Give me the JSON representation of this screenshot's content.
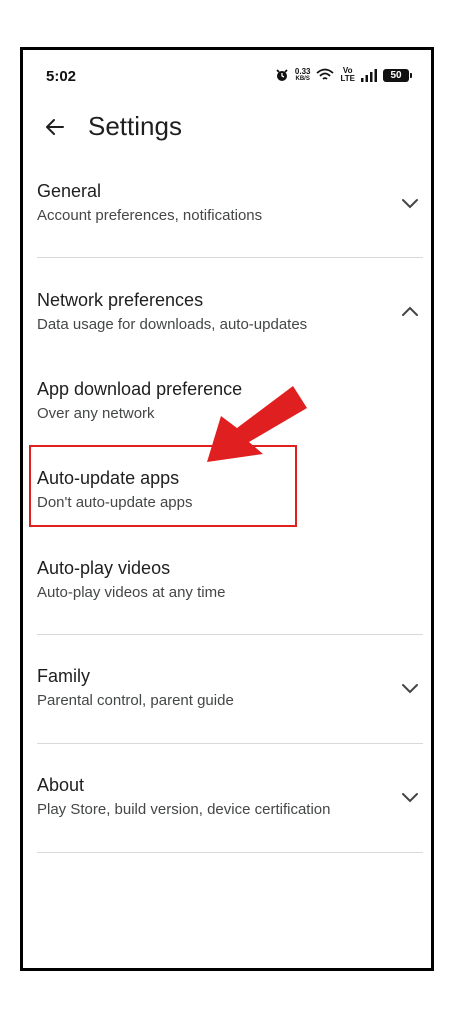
{
  "status_bar": {
    "time": "5:02",
    "net_speed_value": "0.33",
    "net_speed_unit": "KB/S",
    "volte_line1": "Vo",
    "volte_line2": "LTE",
    "battery": "50"
  },
  "app_bar": {
    "back_icon": "arrow-left-icon",
    "title": "Settings"
  },
  "sections": {
    "general": {
      "title": "General",
      "subtitle": "Account preferences, notifications",
      "state": "collapsed"
    },
    "network": {
      "title": "Network preferences",
      "subtitle": "Data usage for downloads, auto-updates",
      "state": "expanded"
    },
    "app_download": {
      "title": "App download preference",
      "subtitle": "Over any network"
    },
    "auto_update": {
      "title": "Auto-update apps",
      "subtitle": "Don't auto-update apps"
    },
    "auto_play": {
      "title": "Auto-play videos",
      "subtitle": "Auto-play videos at any time"
    },
    "family": {
      "title": "Family",
      "subtitle": "Parental control, parent guide",
      "state": "collapsed"
    },
    "about": {
      "title": "About",
      "subtitle": "Play Store, build version, device certification",
      "state": "collapsed"
    }
  },
  "annotation": {
    "color": "#e02020",
    "target": "Auto-update apps"
  }
}
